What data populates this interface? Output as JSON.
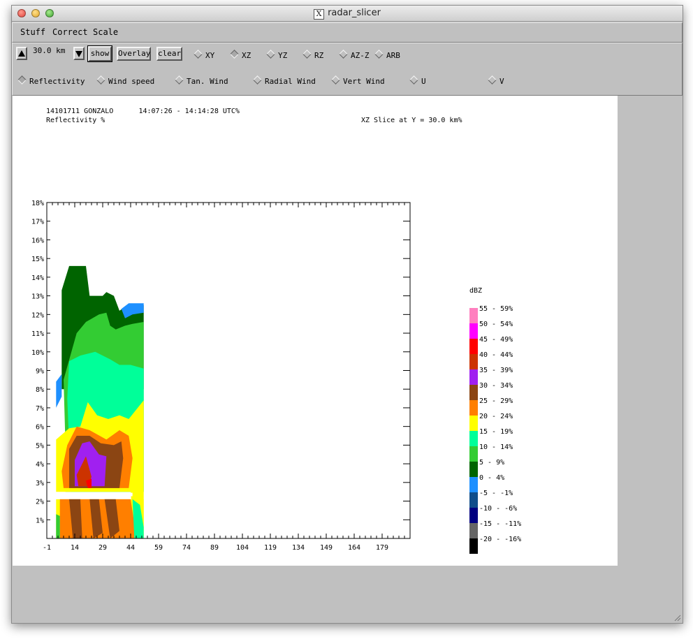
{
  "window": {
    "title": "radar_slicer"
  },
  "menu": {
    "items": [
      "Stuff",
      "Correct",
      "Scale"
    ]
  },
  "toolbar": {
    "value": "30.0 km",
    "show_label": "show",
    "overlay_label": "Overlay",
    "clear_label": "clear",
    "slice_options": [
      "XY",
      "XZ",
      "YZ",
      "RZ",
      "AZ-Z",
      "ARB"
    ],
    "slice_selected": "XZ",
    "field_options": [
      "Reflectivity",
      "Wind speed",
      "Tan. Wind",
      "Radial Wind",
      "Vert Wind",
      "U",
      "V"
    ],
    "field_selected": "Reflectivity"
  },
  "plot": {
    "header_line1": "14101711 GONZALO      14:07:26 - 14:14:28 UTC%",
    "header_line2": "Reflectivity %",
    "slice_info": "XZ Slice at Y = 30.0 km%",
    "legend_title": "dBZ"
  },
  "colors": {
    "window_bg": "#c0c0c0",
    "canvas_bg": "#ffffff"
  },
  "chart_data": {
    "type": "heatmap",
    "title": "XZ Slice at Y = 30.0 km%",
    "xlabel": "",
    "ylabel": "",
    "x_ticks": [
      "-1",
      "14",
      "29",
      "44",
      "59",
      "74",
      "89",
      "104",
      "119",
      "134",
      "149",
      "164",
      "179"
    ],
    "y_ticks": [
      "1%",
      "2%",
      "3%",
      "4%",
      "5%",
      "6%",
      "7%",
      "8%",
      "9%",
      "10%",
      "11%",
      "12%",
      "13%",
      "14%",
      "15%",
      "16%",
      "17%",
      "18%"
    ],
    "xlim": [
      -1,
      194
    ],
    "ylim": [
      0,
      18
    ],
    "legend": [
      {
        "label": "55 - 59%",
        "color": "#ff7fbf"
      },
      {
        "label": "50 - 54%",
        "color": "#ff00ff"
      },
      {
        "label": "45 - 49%",
        "color": "#ff0000"
      },
      {
        "label": "40 - 44%",
        "color": "#cc3300"
      },
      {
        "label": "35 - 39%",
        "color": "#a020f0"
      },
      {
        "label": "30 - 34%",
        "color": "#8b4513"
      },
      {
        "label": "25 - 29%",
        "color": "#ff7f00"
      },
      {
        "label": "20 - 24%",
        "color": "#ffff00"
      },
      {
        "label": "15 - 19%",
        "color": "#00ff99"
      },
      {
        "label": "10 - 14%",
        "color": "#33cc33"
      },
      {
        "label": "5 - 9%",
        "color": "#006400"
      },
      {
        "label": "0 - 4%",
        "color": "#1e90ff"
      },
      {
        "label": "-5 - -1%",
        "color": "#104e8b"
      },
      {
        "label": "-10 - -6%",
        "color": "#000080"
      },
      {
        "label": "-15 - -11%",
        "color": "#666666"
      },
      {
        "label": "-20 - -16%",
        "color": "#000000"
      }
    ],
    "echo_extent": {
      "x_range": [
        4,
        51
      ],
      "top_height": 14.6
    },
    "layers": [
      {
        "band": "5 - 9%",
        "outline": [
          [
            7,
            13.3
          ],
          [
            11,
            14.6
          ],
          [
            20,
            14.6
          ],
          [
            22,
            13
          ],
          [
            29,
            13
          ],
          [
            31,
            13.2
          ],
          [
            35,
            13
          ],
          [
            38,
            12.2
          ],
          [
            42,
            12.5
          ],
          [
            51,
            12.5
          ],
          [
            51,
            8
          ],
          [
            7,
            8
          ]
        ]
      },
      {
        "band": "0 - 4%",
        "outline": [
          [
            39,
            12.3
          ],
          [
            43,
            12.6
          ],
          [
            51,
            12.6
          ],
          [
            51,
            12.1
          ],
          [
            45,
            12.0
          ],
          [
            41,
            11.8
          ]
        ]
      },
      {
        "band": "10 - 14%",
        "outline": [
          [
            15,
            11
          ],
          [
            20,
            11.6
          ],
          [
            27,
            12
          ],
          [
            31,
            12.1
          ],
          [
            33,
            11.4
          ],
          [
            36,
            11.2
          ],
          [
            41,
            11.4
          ],
          [
            45,
            11.5
          ],
          [
            51,
            11.6
          ],
          [
            51,
            2.5
          ],
          [
            9,
            2.5
          ],
          [
            9,
            5
          ],
          [
            8,
            8.5
          ]
        ]
      },
      {
        "band": "15 - 19%",
        "outline": [
          [
            11,
            9.5
          ],
          [
            17,
            9.8
          ],
          [
            25,
            10
          ],
          [
            33,
            9.6
          ],
          [
            38,
            9.3
          ],
          [
            44,
            9.3
          ],
          [
            51,
            9.1
          ],
          [
            51,
            2.5
          ],
          [
            12,
            2.5
          ],
          [
            11,
            5
          ],
          [
            10,
            7.5
          ]
        ]
      },
      {
        "band": "20 - 24%",
        "outline": [
          [
            4,
            5.3
          ],
          [
            11,
            5.9
          ],
          [
            17,
            6
          ],
          [
            21,
            7.3
          ],
          [
            26,
            6.6
          ],
          [
            32,
            6.4
          ],
          [
            38,
            6.6
          ],
          [
            43,
            6.4
          ],
          [
            51,
            7.4
          ],
          [
            51,
            0
          ],
          [
            46,
            0
          ],
          [
            44,
            2.5
          ],
          [
            4,
            2.5
          ]
        ]
      },
      {
        "band": "25 - 29%",
        "outline": [
          [
            7,
            3.6
          ],
          [
            10,
            5
          ],
          [
            15,
            6
          ],
          [
            22,
            5.8
          ],
          [
            31,
            5.3
          ],
          [
            38,
            5.8
          ],
          [
            43,
            5.5
          ],
          [
            45,
            4.3
          ],
          [
            43,
            2.7
          ],
          [
            8,
            2.7
          ]
        ]
      },
      {
        "band": "30 - 34%",
        "outline": [
          [
            11,
            4.8
          ],
          [
            15,
            5.5
          ],
          [
            22,
            5.5
          ],
          [
            28,
            5.1
          ],
          [
            35,
            5
          ],
          [
            39,
            5.2
          ],
          [
            40,
            4.3
          ],
          [
            38,
            2.7
          ],
          [
            11,
            2.7
          ]
        ]
      },
      {
        "band": "35 - 39%",
        "outline": [
          [
            14,
            4.2
          ],
          [
            18,
            5.1
          ],
          [
            22,
            5.2
          ],
          [
            27,
            4.5
          ],
          [
            31,
            4.4
          ],
          [
            30,
            2.8
          ],
          [
            14,
            2.8
          ]
        ]
      },
      {
        "band": "40 - 44%",
        "outline": [
          [
            15,
            3.4
          ],
          [
            18,
            4
          ],
          [
            20,
            4.4
          ],
          [
            23,
            3.3
          ],
          [
            21,
            2.8
          ],
          [
            16,
            2.8
          ]
        ]
      },
      {
        "band": "45 - 49%",
        "outline": [
          [
            20,
            3.1
          ],
          [
            21,
            2.7
          ],
          [
            23,
            2.7
          ],
          [
            23,
            3.2
          ]
        ]
      },
      {
        "band": "20 - 24%",
        "outline": [
          [
            4,
            2.1
          ],
          [
            51,
            2.1
          ],
          [
            51,
            0
          ],
          [
            4,
            0
          ]
        ]
      },
      {
        "band": "25 - 29%",
        "outline": [
          [
            6,
            2.1
          ],
          [
            44,
            2.1
          ],
          [
            46,
            0.8
          ],
          [
            46,
            0
          ],
          [
            6,
            0
          ]
        ]
      },
      {
        "band": "30 - 34%",
        "outline": [
          [
            11,
            2.1
          ],
          [
            17,
            2.1
          ],
          [
            18,
            0
          ],
          [
            13,
            0
          ]
        ]
      },
      {
        "band": "30 - 34%",
        "outline": [
          [
            22,
            2.1
          ],
          [
            27,
            2.1
          ],
          [
            29,
            0.3
          ],
          [
            24,
            0
          ]
        ]
      },
      {
        "band": "30 - 34%",
        "outline": [
          [
            30,
            2.1
          ],
          [
            36,
            2.1
          ],
          [
            38,
            0.4
          ],
          [
            33,
            0
          ]
        ]
      },
      {
        "band": "10 - 14%",
        "outline": [
          [
            4,
            1.3
          ],
          [
            6,
            1.2
          ],
          [
            6,
            0
          ],
          [
            4,
            0
          ]
        ]
      },
      {
        "band": "15 - 19%",
        "outline": [
          [
            45,
            2.1
          ],
          [
            49,
            1.8
          ],
          [
            51,
            0.6
          ],
          [
            51,
            0
          ],
          [
            46,
            0
          ]
        ]
      },
      {
        "band": "0 - 4%",
        "outline": [
          [
            4,
            8.4
          ],
          [
            7,
            8.8
          ],
          [
            7,
            7.6
          ],
          [
            4,
            7
          ]
        ]
      }
    ]
  }
}
